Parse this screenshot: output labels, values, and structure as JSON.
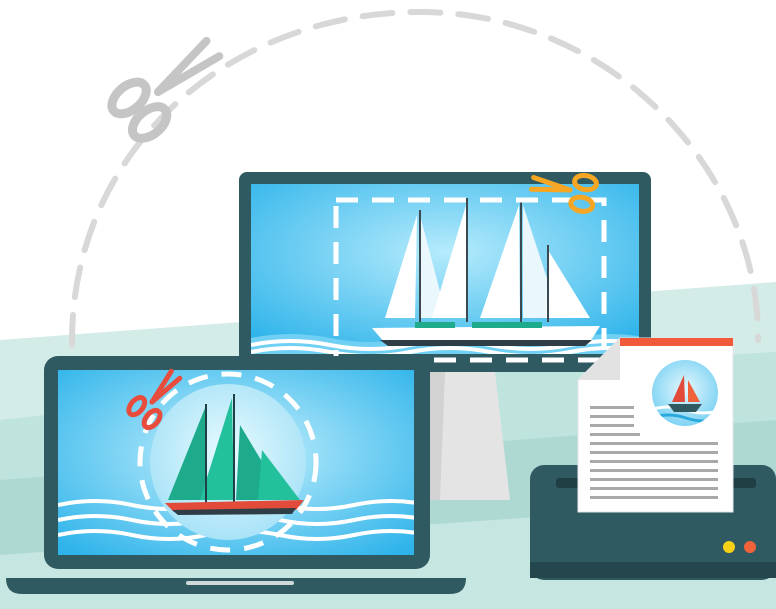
{
  "illustration": {
    "subject": "screenshot-tool",
    "icons": [
      "scissors-icon",
      "monitor-icon",
      "laptop-icon",
      "printer-icon",
      "document-icon",
      "sailboat-icon"
    ]
  },
  "colors": {
    "background": "#ffffff",
    "ground_light": "#cfe9e5",
    "ground_mid": "#b7ddd7",
    "dash_gray": "#d6d6d6",
    "scissors_gray": "#c5c5c5",
    "device_dark": "#2f5a62",
    "screen_blue_light": "#8fdcf8",
    "screen_blue": "#29b6ec",
    "wave_blue": "#5ac8f0",
    "sail_white": "#ffffff",
    "sail_green": "#1dab8c",
    "scissors_orange": "#f6a623",
    "scissors_red": "#e74c3c",
    "paper": "#ffffff",
    "paper_line": "#a9a9a9",
    "paper_accent": "#f05a3a",
    "light_yellow": "#f7d117",
    "light_orange": "#f0623a"
  }
}
